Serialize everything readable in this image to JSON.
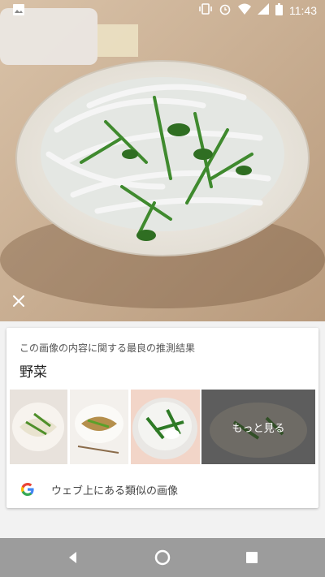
{
  "status": {
    "time": "11:43",
    "icons": [
      "image-icon",
      "vibrate-icon",
      "alarm-icon",
      "wifi-icon",
      "cell-signal-icon",
      "battery-icon"
    ]
  },
  "result": {
    "caption": "この画像の内容に関する最良の推測結果",
    "label": "野菜",
    "more_label": "もっと見る",
    "web_search_label": "ウェブ上にある類似の画像"
  },
  "nav": {
    "buttons": [
      "back-icon",
      "home-icon",
      "recents-icon"
    ]
  },
  "colors": {
    "card_bg": "#ffffff",
    "navbar": "#9c9c9c",
    "page_bg": "#f2f2f2"
  }
}
